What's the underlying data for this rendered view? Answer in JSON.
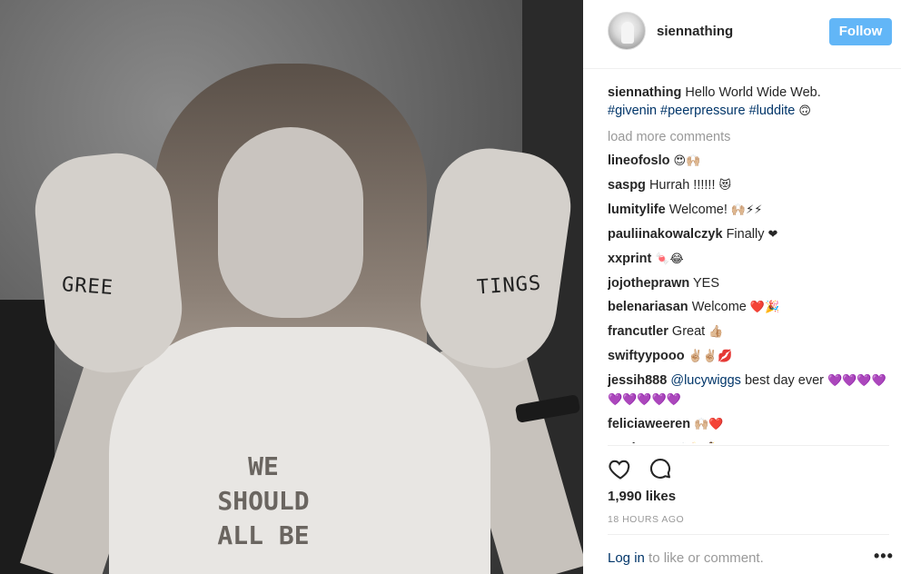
{
  "photo": {
    "left_hand_text": "GREE",
    "right_hand_text": "TINGS",
    "shirt_lines": [
      "WE",
      "SHOULD",
      "ALL BE"
    ]
  },
  "header": {
    "username": "siennathing",
    "follow_label": "Follow"
  },
  "caption": {
    "username": "siennathing",
    "text": "Hello World Wide Web.",
    "hashtags": [
      "#givenin",
      "#peerpressure",
      "#luddite"
    ],
    "emoji": "🙃"
  },
  "load_more": "load more comments",
  "comments": [
    {
      "user": "lineofoslo",
      "text": "",
      "emoji": "😍🙌🏼"
    },
    {
      "user": "saspg",
      "text": "Hurrah !!!!!!",
      "emoji": "😻"
    },
    {
      "user": "lumitylife",
      "text": "Welcome!",
      "emoji": "🙌🏼⚡⚡"
    },
    {
      "user": "pauliinakowalczyk",
      "text": "Finally",
      "emoji": "❤"
    },
    {
      "user": "xxprint",
      "text": "",
      "emoji": "🍬😂"
    },
    {
      "user": "jojotheprawn",
      "text": "YES",
      "emoji": ""
    },
    {
      "user": "belenariasan",
      "text": "Welcome",
      "emoji": "❤️🎉"
    },
    {
      "user": "francutler",
      "text": "Great",
      "emoji": "👍🏼"
    },
    {
      "user": "swiftyypooo",
      "text": "",
      "emoji": "✌🏼✌🏼💋"
    },
    {
      "user": "jessih888",
      "mention": "@lucywiggs",
      "text": "best day ever",
      "emoji": "💜💜💜💜💜💜💜💜💜"
    },
    {
      "user": "feliciaweeren",
      "text": "",
      "emoji": "🙌🏼❤️"
    },
    {
      "user": "mariasass",
      "text": "",
      "emoji": "🙌🏼🍾💃"
    }
  ],
  "likes": "1,990 likes",
  "timestamp": "18 HOURS AGO",
  "footer": {
    "login_label": "Log in",
    "rest": "to like or comment.",
    "more": "•••"
  },
  "colors": {
    "follow": "#62b6f7",
    "link": "#003569",
    "muted": "#999999"
  }
}
